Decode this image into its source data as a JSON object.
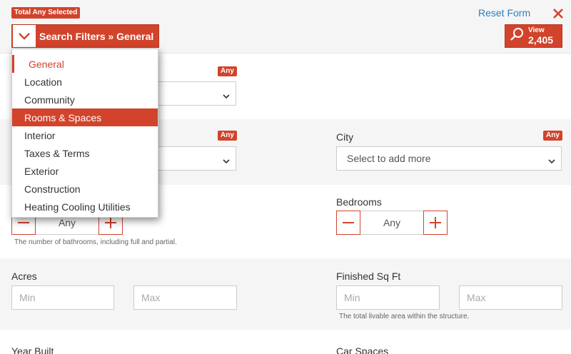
{
  "header": {
    "total_badge": "Total Any Selected",
    "filters_button_label": "Search Filters » General",
    "reset_label": "Reset Form",
    "view_label": "View",
    "view_count": "2,405"
  },
  "menu": {
    "items": [
      "General",
      "Location",
      "Community",
      "Rooms & Spaces",
      "Interior",
      "Taxes & Terms",
      "Exterior",
      "Construction",
      "Heating Cooling Utilities"
    ],
    "current": "General",
    "highlighted": "Rooms & Spaces"
  },
  "fields": {
    "row1": {
      "any_badge": "Any"
    },
    "row2": {
      "any_badge_left": "Any",
      "city_label": "City",
      "city_any_badge": "Any",
      "city_placeholder": "Select to add more"
    },
    "row3": {
      "bath_value": "Any",
      "bath_hint": "The number of bathrooms, including full and partial.",
      "bedrooms_label": "Bedrooms",
      "bedrooms_value": "Any"
    },
    "row4": {
      "acres_label": "Acres",
      "acres_min": "Min",
      "acres_max": "Max",
      "sqft_label": "Finished Sq Ft",
      "sqft_min": "Min",
      "sqft_max": "Max",
      "sqft_hint": "The total livable area within the structure."
    },
    "row5": {
      "year_label": "Year Built",
      "car_label": "Car Spaces"
    }
  },
  "colors": {
    "accent": "#d2432c",
    "link": "#2d7fc1"
  },
  "icons": {
    "chevron": "chevron-down-icon",
    "close": "close-icon",
    "search": "search-icon",
    "minus": "minus-icon",
    "plus": "plus-icon"
  }
}
